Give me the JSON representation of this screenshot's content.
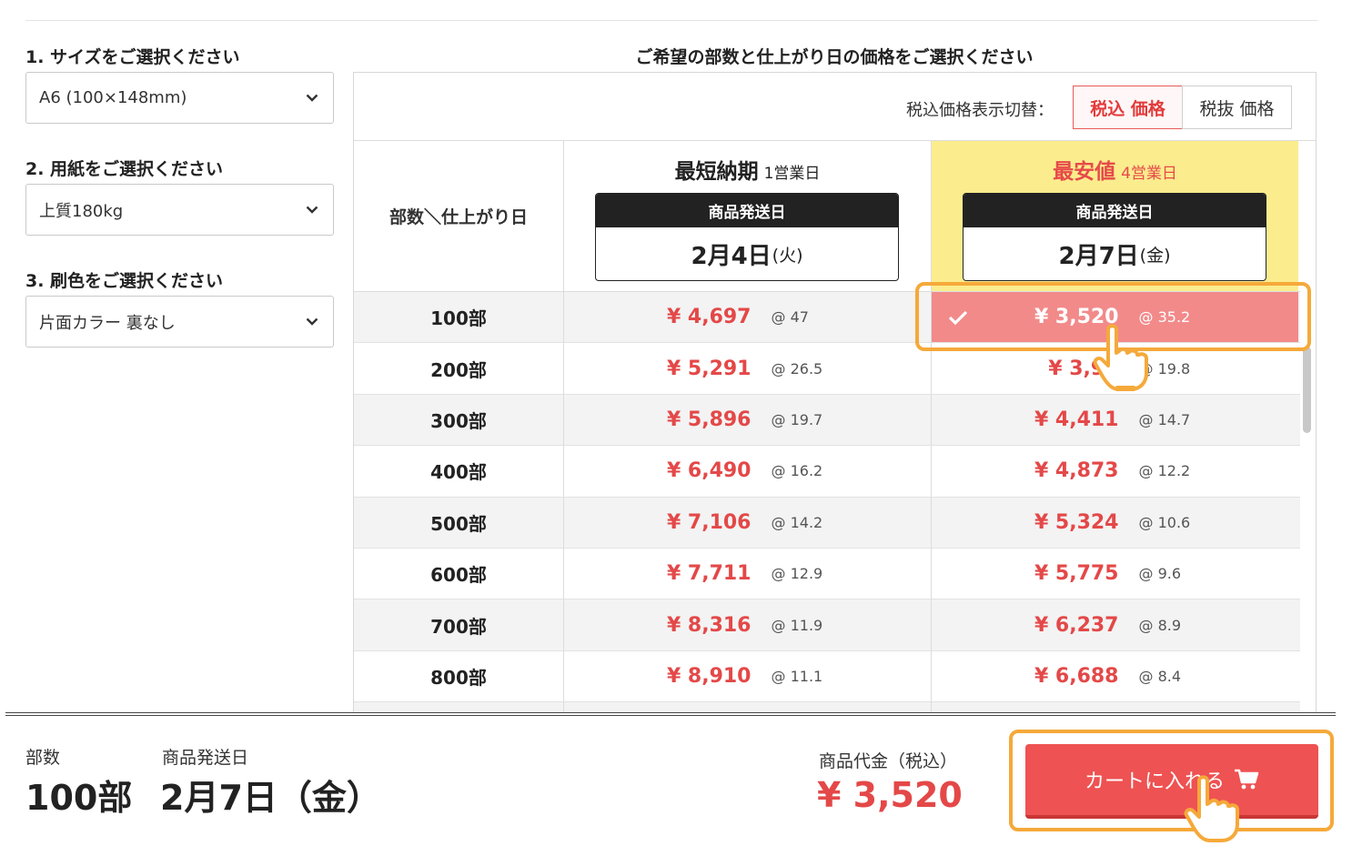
{
  "steps": [
    {
      "label": "1. サイズをご選択ください",
      "value": "A6 (100×148mm)"
    },
    {
      "label": "2. 用紙をご選択ください",
      "value": "上質180kg"
    },
    {
      "label": "3. 刷色をご選択ください",
      "value": "片面カラー 裏なし"
    }
  ],
  "table": {
    "heading": "ご希望の部数と仕上がり日の価格をご選択ください",
    "tax_label": "税込価格表示切替：",
    "tax_incl": "税込 価格",
    "tax_excl": "税抜 価格",
    "qty_header": "部数＼仕上がり日",
    "fast": {
      "title": "最短納期",
      "sub": "1営業日",
      "ship_label": "商品発送日",
      "date": "2月4日",
      "weekday": "(火)"
    },
    "cheap": {
      "title": "最安値",
      "sub": "4営業日",
      "ship_label": "商品発送日",
      "date": "2月7日",
      "weekday": "(金)"
    },
    "rows": [
      {
        "qty": "100部",
        "fast_price": "¥ 4,697",
        "fast_unit": "@ 47",
        "cheap_price": "¥ 3,520",
        "cheap_unit": "@ 35.2"
      },
      {
        "qty": "200部",
        "fast_price": "¥ 5,291",
        "fast_unit": "@ 26.5",
        "cheap_price": "¥ 3,96",
        "cheap_unit": "@ 19.8"
      },
      {
        "qty": "300部",
        "fast_price": "¥ 5,896",
        "fast_unit": "@ 19.7",
        "cheap_price": "¥ 4,411",
        "cheap_unit": "@ 14.7"
      },
      {
        "qty": "400部",
        "fast_price": "¥ 6,490",
        "fast_unit": "@ 16.2",
        "cheap_price": "¥ 4,873",
        "cheap_unit": "@ 12.2"
      },
      {
        "qty": "500部",
        "fast_price": "¥ 7,106",
        "fast_unit": "@ 14.2",
        "cheap_price": "¥ 5,324",
        "cheap_unit": "@ 10.6"
      },
      {
        "qty": "600部",
        "fast_price": "¥ 7,711",
        "fast_unit": "@ 12.9",
        "cheap_price": "¥ 5,775",
        "cheap_unit": "@ 9.6"
      },
      {
        "qty": "700部",
        "fast_price": "¥ 8,316",
        "fast_unit": "@ 11.9",
        "cheap_price": "¥ 6,237",
        "cheap_unit": "@ 8.9"
      },
      {
        "qty": "800部",
        "fast_price": "¥ 8,910",
        "fast_unit": "@ 11.1",
        "cheap_price": "¥ 6,688",
        "cheap_unit": "@ 8.4"
      }
    ],
    "selected_row": 0,
    "selected_col": "cheap"
  },
  "footer": {
    "qty_label": "部数",
    "qty_value": "100部",
    "ship_label": "商品発送日",
    "ship_value": "2月7日（金）",
    "total_label": "商品代金（税込）",
    "total_value": "¥ 3,520",
    "cart_label": "カートに入れる"
  },
  "colors": {
    "accent": "#ee5252",
    "price": "#e44848",
    "highlight": "#fbec8d",
    "selected": "#f28a8a",
    "callout": "#f5a93a"
  },
  "icons": [
    "chevron-down-icon",
    "check-icon",
    "cart-icon",
    "pointer-hand-icon"
  ]
}
